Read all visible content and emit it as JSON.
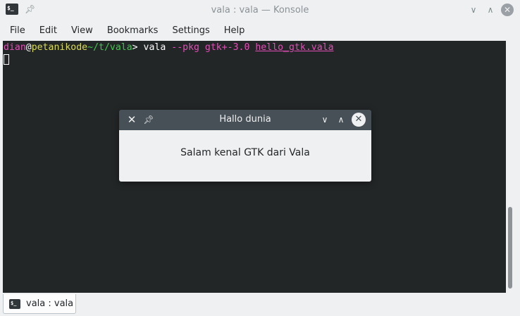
{
  "window": {
    "title": "vala : vala — Konsole",
    "app_icon": "terminal-icon",
    "app_icon_text": "$_"
  },
  "menubar": {
    "items": [
      {
        "label": "File"
      },
      {
        "label": "Edit"
      },
      {
        "label": "View"
      },
      {
        "label": "Bookmarks"
      },
      {
        "label": "Settings"
      },
      {
        "label": "Help"
      }
    ]
  },
  "terminal": {
    "prompt_user": "dian",
    "prompt_at": "@",
    "prompt_host": "petanikode",
    "prompt_path": "~/t/vala",
    "prompt_symbol": "> ",
    "command": "vala ",
    "flag": "--pkg gtk+-3.0",
    "space": " ",
    "file": "hello_gtk.vala",
    "colors": {
      "background": "#232627",
      "user": "#e04eb6",
      "host": "#dadb5a",
      "path": "#3ec94a",
      "text": "#fcfcfc"
    }
  },
  "tabbar": {
    "tabs": [
      {
        "label": "vala : vala",
        "icon": "terminal-icon",
        "icon_text": "$_"
      }
    ]
  },
  "dialog": {
    "title": "Hallo dunia",
    "message": "Salam kenal GTK dari Vala",
    "titlebar_color": "#475057"
  }
}
